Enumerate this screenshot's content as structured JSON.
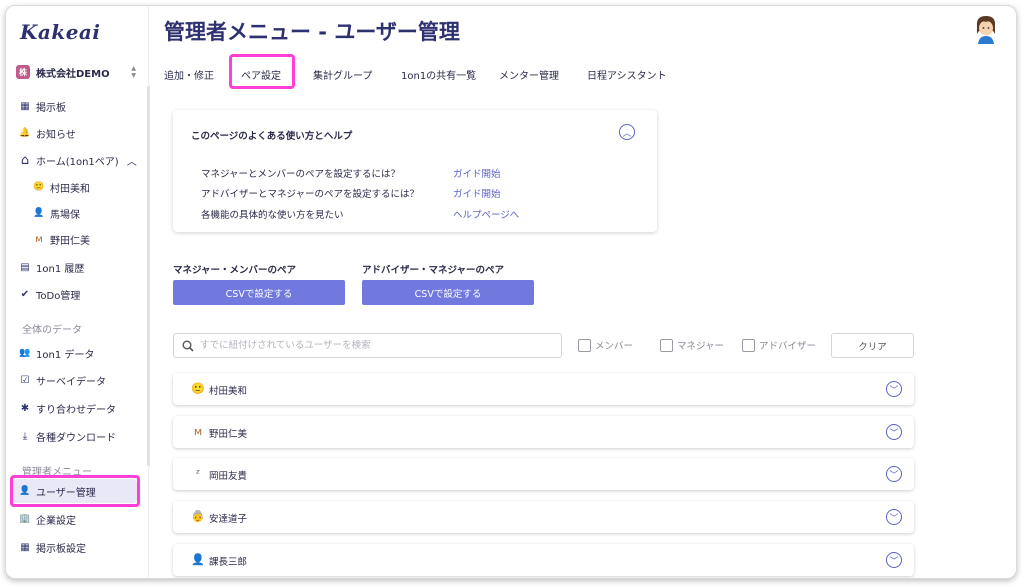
{
  "app": {
    "logo": "Kakeai"
  },
  "company": {
    "badge": "株",
    "name": "株式会社DEMO",
    "switch_up": "▲",
    "switch_down": "▼"
  },
  "sidebar": {
    "items": [
      {
        "label": "掲示板",
        "icon": "bulletin-board-icon",
        "glyph": "▦"
      },
      {
        "label": "お知らせ",
        "icon": "bell-icon",
        "glyph": "🔔"
      },
      {
        "label": "ホーム(1on1ペア)",
        "icon": "home-icon",
        "glyph": "⌂",
        "chevron": "︿"
      },
      {
        "label": "村田美和",
        "icon": "user-avatar-icon",
        "glyph": "🙂"
      },
      {
        "label": "馬場保",
        "icon": "user-avatar-icon",
        "glyph": "👤"
      },
      {
        "label": "野田仁美",
        "icon": "user-avatar-icon",
        "glyph": "ᴍ"
      },
      {
        "label": "1on1 履歴",
        "icon": "history-icon",
        "glyph": "▤"
      },
      {
        "label": "ToDo管理",
        "icon": "check-circle-icon",
        "glyph": "✔"
      },
      {
        "label": "1on1 データ",
        "icon": "people-icon",
        "glyph": "👥"
      },
      {
        "label": "サーベイデータ",
        "icon": "survey-icon",
        "glyph": "☑"
      },
      {
        "label": "すり合わせデータ",
        "icon": "puzzle-icon",
        "glyph": "✱"
      },
      {
        "label": "各種ダウンロード",
        "icon": "download-icon",
        "glyph": "⤓"
      },
      {
        "label": "ユーザー管理",
        "icon": "user-manage-icon",
        "glyph": "👤"
      },
      {
        "label": "企業設定",
        "icon": "company-icon",
        "glyph": "🏢"
      },
      {
        "label": "掲示板設定",
        "icon": "board-settings-icon",
        "glyph": "▦"
      }
    ],
    "sections": {
      "data": "全体のデータ",
      "admin": "管理者メニュー"
    }
  },
  "header": {
    "title": "管理者メニュー - ユーザー管理"
  },
  "tabs": [
    {
      "label": "追加・修正"
    },
    {
      "label": "ペア設定"
    },
    {
      "label": "集計グループ"
    },
    {
      "label": "1on1の共有一覧"
    },
    {
      "label": "メンター管理"
    },
    {
      "label": "日程アシスタント"
    }
  ],
  "help": {
    "title": "このページのよくある使い方とヘルプ",
    "toggle": "︿",
    "rows": [
      {
        "text": "マネジャーとメンバーのペアを設定するには？",
        "link": "ガイド開始"
      },
      {
        "text": "アドバイザーとマネジャーのペアを設定するには？",
        "link": "ガイド開始"
      },
      {
        "text": "各機能の具体的な使い方を見たい",
        "link": "ヘルプページへ"
      }
    ]
  },
  "pairs": {
    "manager_member": {
      "label": "マネジャー・メンバーのペア",
      "button": "CSVで設定する"
    },
    "advisor_manager": {
      "label": "アドバイザー・マネジャーのペア",
      "button": "CSVで設定する"
    }
  },
  "filter": {
    "search_placeholder": "すでに紐付けされているユーザーを検索",
    "search_value": "",
    "checkboxes": [
      {
        "label": "メンバー"
      },
      {
        "label": "マネジャー"
      },
      {
        "label": "アドバイザー"
      }
    ],
    "clear": "クリア"
  },
  "users": [
    {
      "name": "村田美和",
      "icon": "user-avatar-icon",
      "glyph": "🙂"
    },
    {
      "name": "野田仁美",
      "icon": "user-avatar-icon",
      "glyph": "ᴍ"
    },
    {
      "name": "岡田友貴",
      "icon": "user-avatar-icon",
      "glyph": "ᶻ"
    },
    {
      "name": "安達道子",
      "icon": "user-avatar-icon",
      "glyph": "👵"
    },
    {
      "name": "課長三郎",
      "icon": "user-avatar-icon",
      "glyph": "👤"
    }
  ],
  "expand_glyph": "﹀",
  "colors": {
    "accent": "#7179de",
    "brand": "#2e3170",
    "highlight": "#ff3fd6"
  }
}
